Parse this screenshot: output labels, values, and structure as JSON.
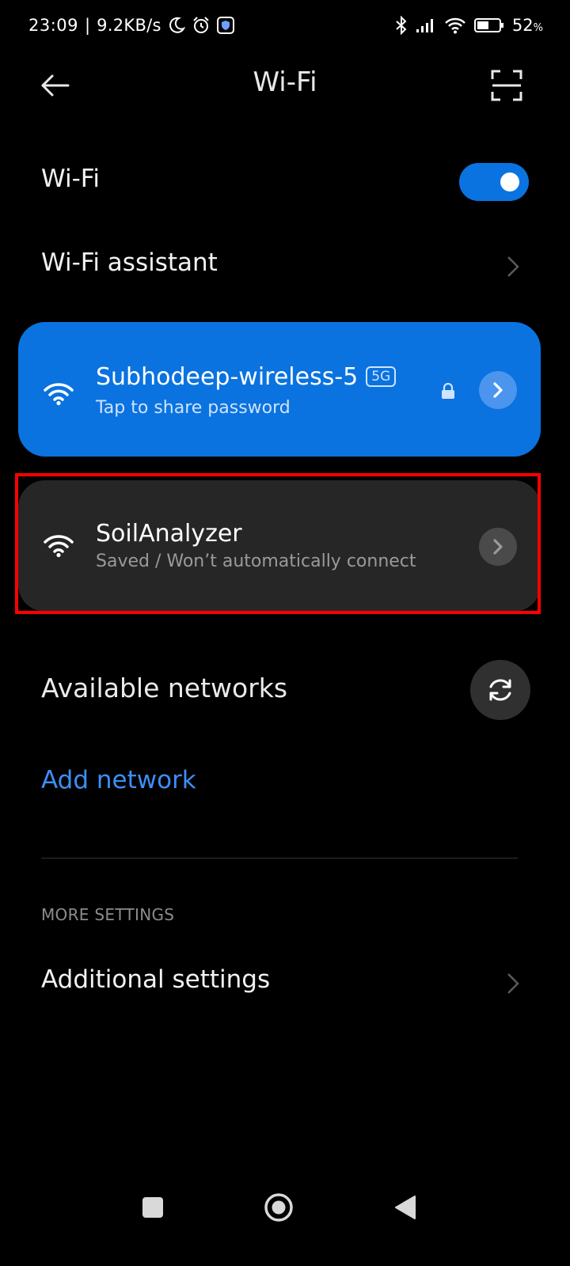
{
  "status_bar": {
    "time": "23:09",
    "separator": "|",
    "network_speed": "9.2KB/s",
    "icons": [
      "moon-icon",
      "alarm-icon",
      "vpn-shield-icon",
      "bluetooth-icon",
      "cell-signal-icon",
      "wifi-signal-icon",
      "battery-icon"
    ],
    "battery_value": "52",
    "battery_unit": "%"
  },
  "header": {
    "title": "Wi-Fi",
    "back_icon": "arrow-left-icon",
    "scan_icon": "scan-qr-icon"
  },
  "wifi_toggle": {
    "label": "Wi-Fi",
    "enabled": true
  },
  "wifi_assistant": {
    "label": "Wi-Fi assistant"
  },
  "networks": [
    {
      "name": "Subhodeep-wireless-5",
      "band": "5G",
      "status": "Tap to share password",
      "state": "connected",
      "secured": true
    },
    {
      "name": "SoilAnalyzer",
      "status": "Saved / Won’t automatically connect",
      "state": "saved",
      "highlighted": true
    }
  ],
  "available_networks": {
    "heading": "Available networks",
    "refresh_icon": "refresh-icon"
  },
  "add_network": {
    "label": "Add network"
  },
  "more_settings": {
    "header": "MORE SETTINGS",
    "additional_settings_label": "Additional settings"
  },
  "nav_bar": {
    "icons": [
      "recents-square-icon",
      "home-circle-icon",
      "back-triangle-icon"
    ]
  },
  "colors": {
    "background": "#000000",
    "accent_blue": "#0a73e0",
    "link_blue": "#3d8ef5",
    "card_dark": "#262626",
    "highlight_red": "#ff0000",
    "detail_button_light": "#4b95ee",
    "detail_button_dark": "#4a4a4a",
    "refresh_button_bg": "#303030"
  }
}
